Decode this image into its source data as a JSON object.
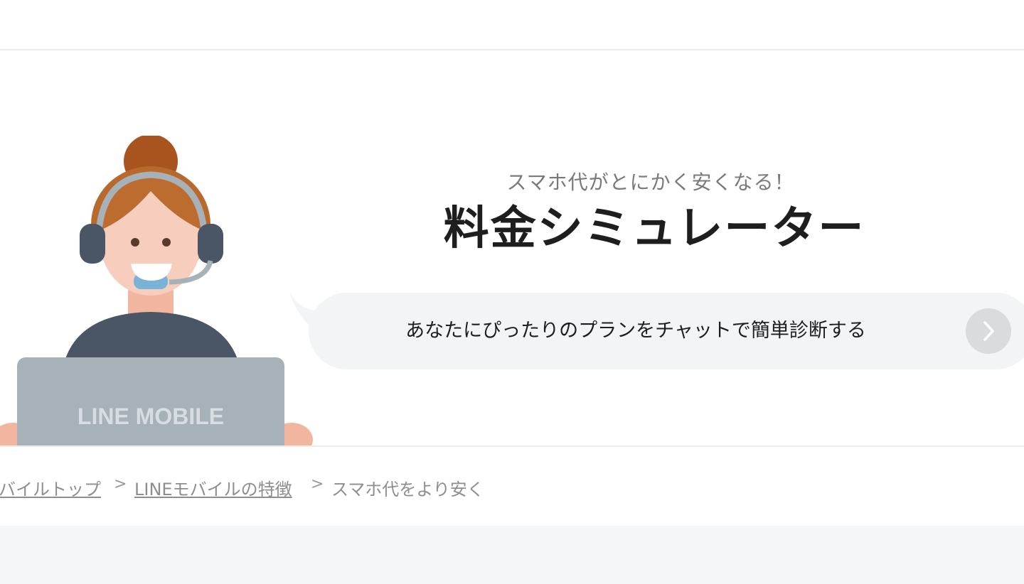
{
  "hero": {
    "subtitle": "スマホ代がとにかく安くなる！",
    "title": "料金シミュレーター",
    "chat_button_label": "あなたにぴったりのプランをチャットで簡単診断する",
    "chat_button_icon": "chevron-right-icon",
    "illustration_laptop_text": "LINE MOBILE"
  },
  "breadcrumb": {
    "items": [
      {
        "label": "バイルトップ",
        "link": true
      },
      {
        "label": "LINEモバイルの特徴",
        "link": true
      },
      {
        "label": "スマホ代をより安く",
        "link": false
      }
    ],
    "separator": ">"
  },
  "colors": {
    "title": "#1e1e1e",
    "subtitle": "#7a7a7a",
    "bubble_bg": "#f3f4f6",
    "arrow_bg": "#d8dcdf",
    "hair": "#b5612a",
    "headset": "#4a5566",
    "laptop": "#a7b1b8"
  }
}
